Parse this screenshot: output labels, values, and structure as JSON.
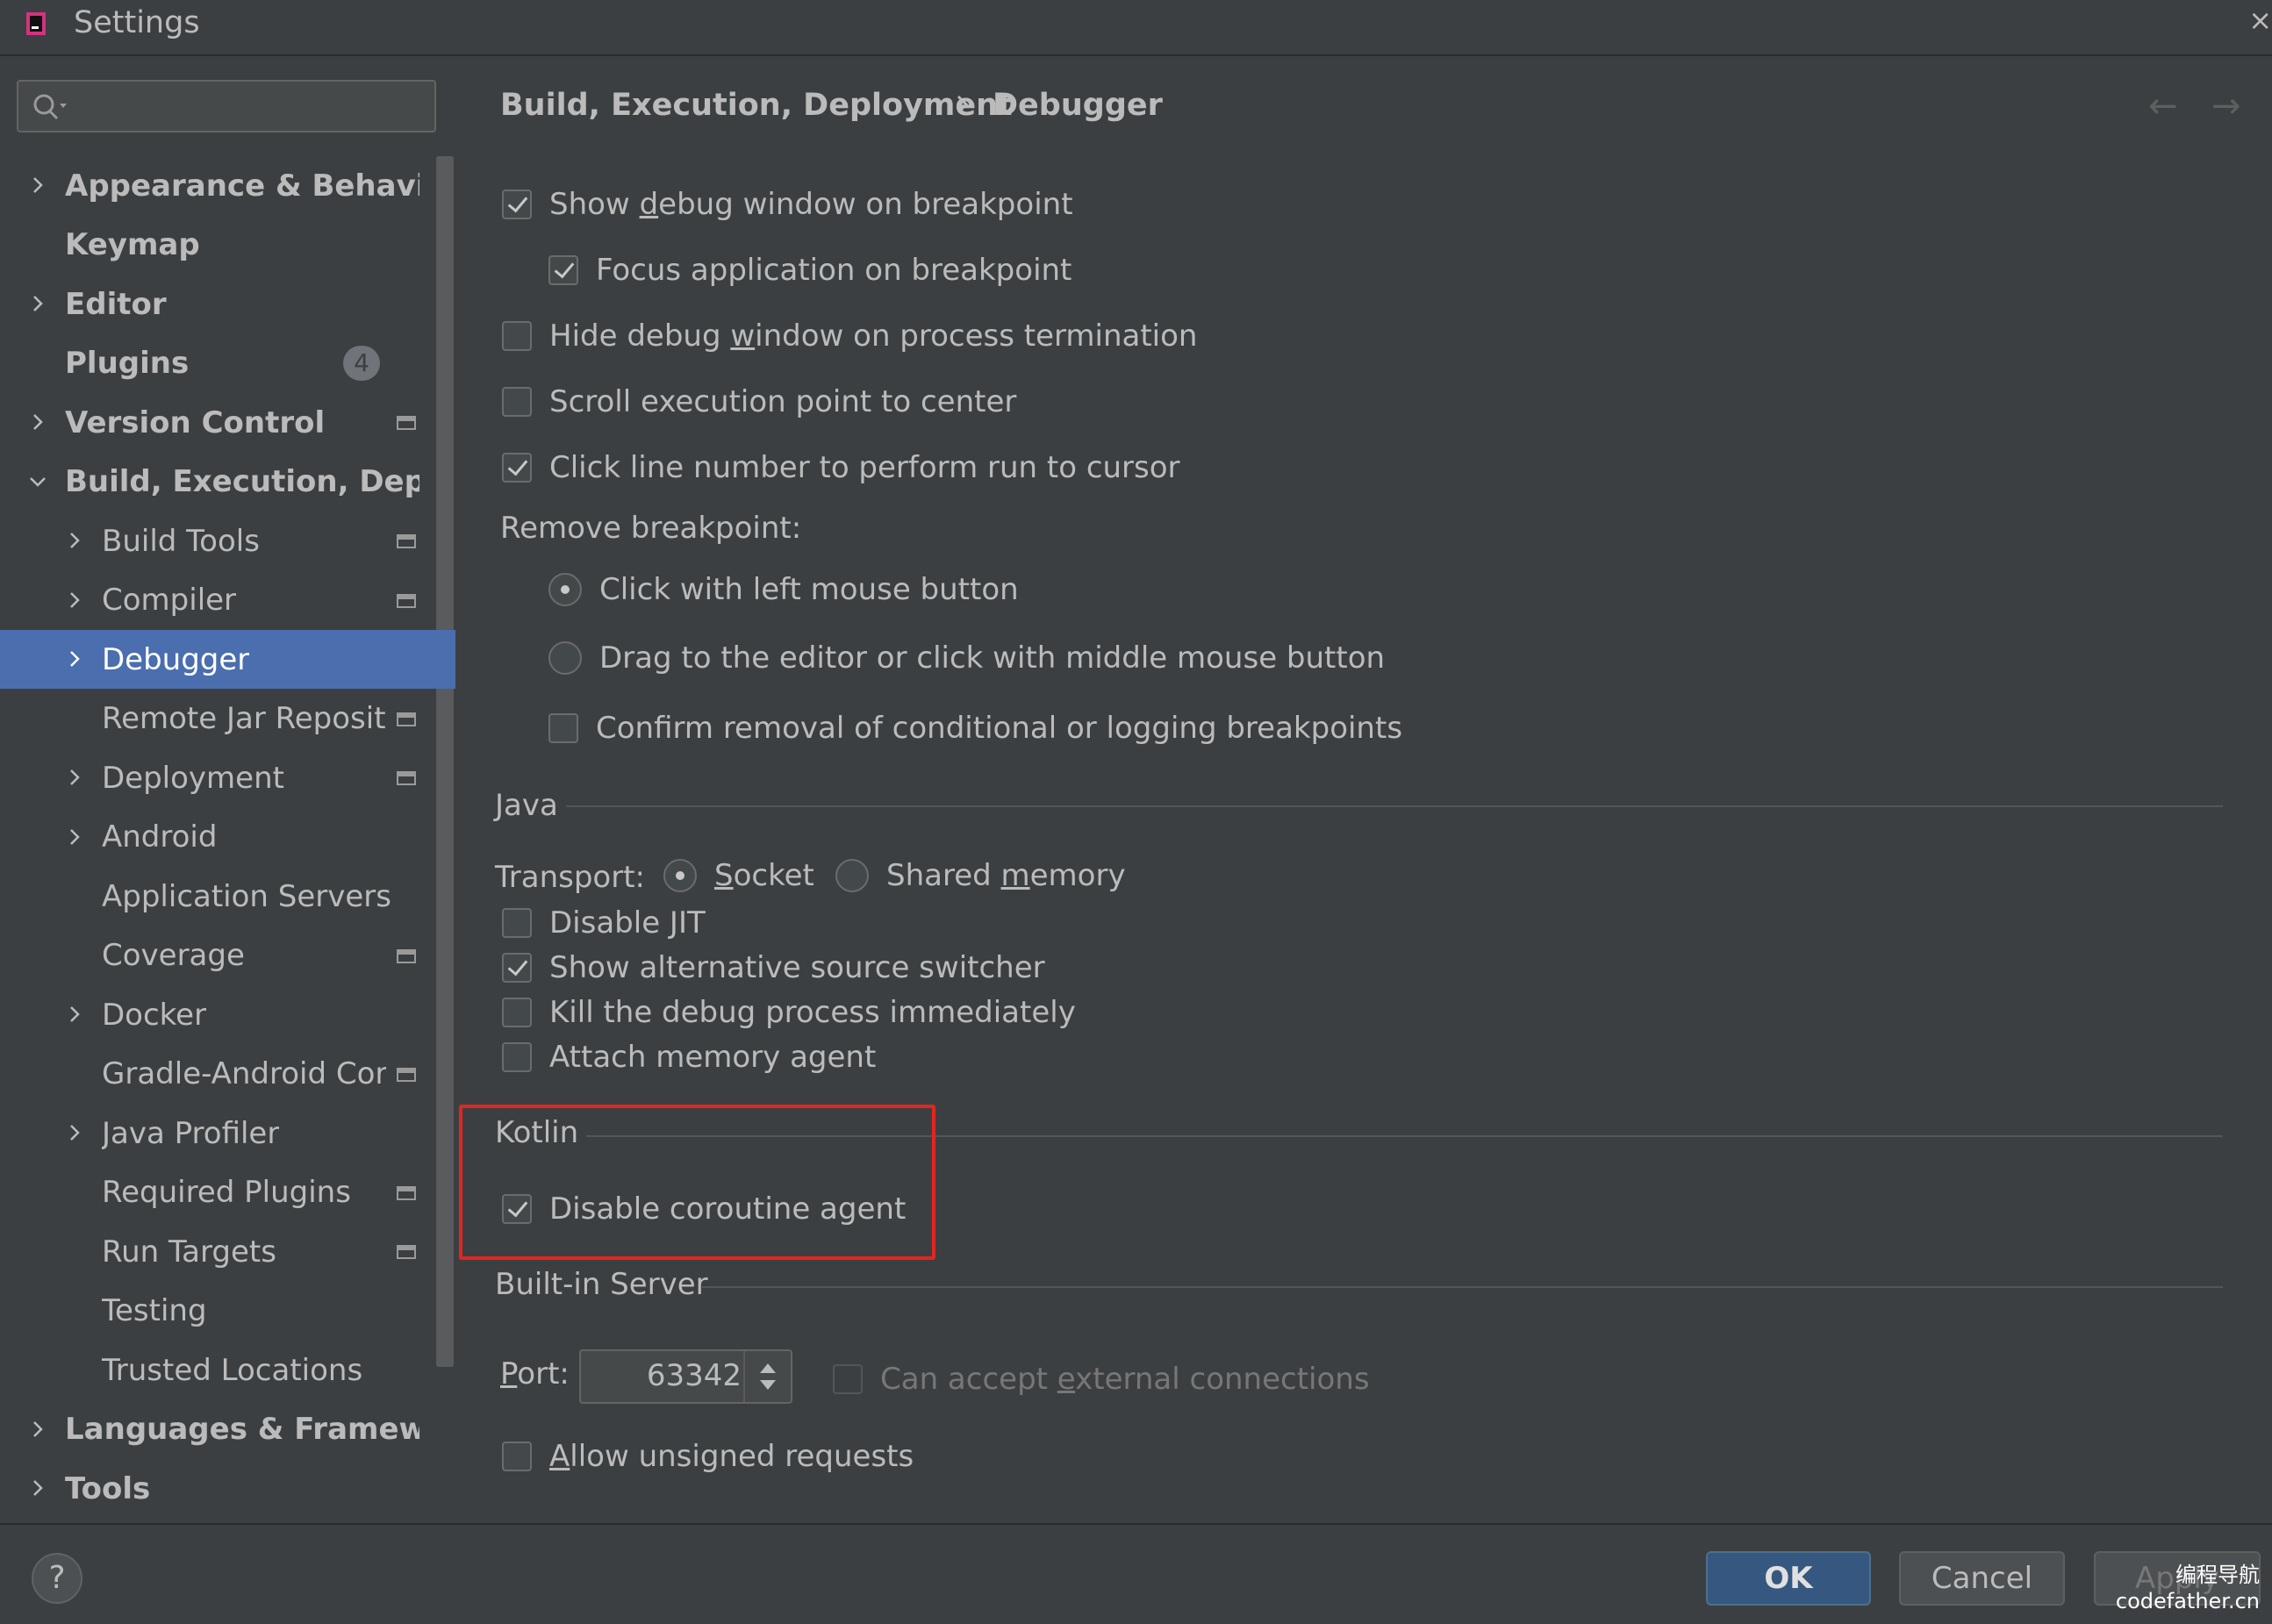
{
  "window": {
    "title": "Settings"
  },
  "search": {
    "placeholder": ""
  },
  "sidebar": {
    "items": [
      {
        "label": "Appearance & Behavior",
        "level": 0,
        "expandable": true,
        "expanded": false,
        "icon": false
      },
      {
        "label": "Keymap",
        "level": 0,
        "expandable": false,
        "icon": false
      },
      {
        "label": "Editor",
        "level": 0,
        "expandable": true,
        "expanded": false,
        "icon": false
      },
      {
        "label": "Plugins",
        "level": 0,
        "expandable": false,
        "badge": "4",
        "icon": false
      },
      {
        "label": "Version Control",
        "level": 0,
        "expandable": true,
        "expanded": false,
        "icon": true
      },
      {
        "label": "Build, Execution, Deploy",
        "level": 0,
        "expandable": true,
        "expanded": true,
        "icon": false
      },
      {
        "label": "Build Tools",
        "level": 1,
        "expandable": true,
        "expanded": false,
        "icon": true
      },
      {
        "label": "Compiler",
        "level": 1,
        "expandable": true,
        "expanded": false,
        "icon": true
      },
      {
        "label": "Debugger",
        "level": 1,
        "expandable": true,
        "expanded": false,
        "icon": false,
        "selected": true
      },
      {
        "label": "Remote Jar Reposito",
        "level": 1,
        "expandable": false,
        "icon": true
      },
      {
        "label": "Deployment",
        "level": 1,
        "expandable": true,
        "expanded": false,
        "icon": true
      },
      {
        "label": "Android",
        "level": 1,
        "expandable": true,
        "expanded": false,
        "icon": false
      },
      {
        "label": "Application Servers",
        "level": 1,
        "expandable": false,
        "icon": false
      },
      {
        "label": "Coverage",
        "level": 1,
        "expandable": false,
        "icon": true
      },
      {
        "label": "Docker",
        "level": 1,
        "expandable": true,
        "expanded": false,
        "icon": false
      },
      {
        "label": "Gradle-Android Cor",
        "level": 1,
        "expandable": false,
        "icon": true
      },
      {
        "label": "Java Profiler",
        "level": 1,
        "expandable": true,
        "expanded": false,
        "icon": false
      },
      {
        "label": "Required Plugins",
        "level": 1,
        "expandable": false,
        "icon": true
      },
      {
        "label": "Run Targets",
        "level": 1,
        "expandable": false,
        "icon": true
      },
      {
        "label": "Testing",
        "level": 1,
        "expandable": false,
        "icon": false
      },
      {
        "label": "Trusted Locations",
        "level": 1,
        "expandable": false,
        "icon": false
      },
      {
        "label": "Languages & Frameworl",
        "level": 0,
        "expandable": true,
        "expanded": false,
        "icon": false
      },
      {
        "label": "Tools",
        "level": 0,
        "expandable": true,
        "expanded": false,
        "icon": false
      }
    ]
  },
  "breadcrumb": {
    "parent": "Build, Execution, Deployment",
    "current": "Debugger"
  },
  "debugger": {
    "show_debug_window": {
      "pre": "Show ",
      "mn": "d",
      "post": "ebug window on breakpoint",
      "checked": true
    },
    "focus_application": {
      "label": "Focus application on breakpoint",
      "checked": true
    },
    "hide_debug_window": {
      "pre": "Hide debug ",
      "mn": "w",
      "post": "indow on process termination",
      "checked": false
    },
    "scroll_execution": {
      "label": "Scroll execution point to center",
      "checked": false
    },
    "click_line_number": {
      "label": "Click line number to perform run to cursor",
      "checked": true
    },
    "remove_breakpoint_label": "Remove breakpoint:",
    "remove_left_click": {
      "label": "Click with left mouse button",
      "selected": true
    },
    "remove_drag": {
      "label": "Drag to the editor or click with middle mouse button",
      "selected": false
    },
    "confirm_removal": {
      "label": "Confirm removal of conditional or logging breakpoints",
      "checked": false
    }
  },
  "java": {
    "section_title": "Java",
    "transport_label": "Transport:",
    "socket": {
      "mn": "S",
      "post": "ocket",
      "selected": true
    },
    "shared_memory": {
      "pre": "Shared ",
      "mn": "m",
      "post": "emory",
      "selected": false
    },
    "disable_jit": {
      "label": "Disable JIT",
      "checked": false
    },
    "alt_source_switcher": {
      "label": "Show alternative source switcher",
      "checked": true
    },
    "kill_debug": {
      "label": "Kill the debug process immediately",
      "checked": false
    },
    "attach_memory": {
      "label": "Attach memory agent",
      "checked": false
    }
  },
  "kotlin": {
    "section_title": "Kotlin",
    "disable_coroutine": {
      "label": "Disable coroutine agent",
      "checked": true
    }
  },
  "builtin_server": {
    "section_title": "Built-in Server",
    "port_mn": "P",
    "port_post": "ort:",
    "port_value": "63342",
    "accept_external": {
      "pre": "Can accept ",
      "mn": "e",
      "post": "xternal connections",
      "checked": false,
      "enabled": false
    },
    "allow_unsigned": {
      "mn": "A",
      "post": "llow unsigned requests",
      "checked": false
    }
  },
  "buttons": {
    "help": "?",
    "ok": "OK",
    "cancel": "Cancel",
    "apply": "Apply"
  },
  "watermark": {
    "line1": "编程导航",
    "line2": "codefather.cn"
  },
  "colors": {
    "background": "#3c3f41",
    "selection": "#4b6eaf",
    "ok": "#365880",
    "highlight": "#e3261f"
  }
}
